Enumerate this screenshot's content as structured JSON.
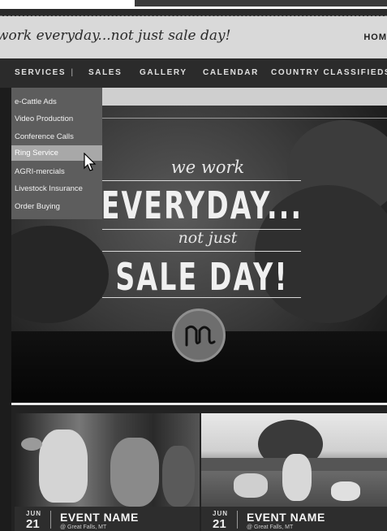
{
  "header": {
    "tagline": "work everyday...not just sale day!",
    "home_label": "HOM"
  },
  "nav": {
    "items": [
      {
        "label": "SERVICES"
      },
      {
        "label": "SALES"
      },
      {
        "label": "GALLERY"
      },
      {
        "label": "CALENDAR"
      },
      {
        "label": "COUNTRY CLASSIFIEDS"
      }
    ]
  },
  "dropdown": {
    "items": [
      {
        "label": "e-Cattle Ads"
      },
      {
        "label": "Video Production"
      },
      {
        "label": "Conference Calls"
      },
      {
        "label": "Ring Service",
        "active": true
      },
      {
        "label": "AGRI-mercials"
      },
      {
        "label": "Livestock Insurance"
      },
      {
        "label": "Order Buying"
      }
    ]
  },
  "hero": {
    "we_work": "we work",
    "everyday": "EVERYDAY...",
    "not_just": "not just",
    "sale_day": "SALE DAY!"
  },
  "events": [
    {
      "month": "JUN",
      "day": "21",
      "name": "EVENT NAME",
      "location": "@ Great Falls, MT"
    },
    {
      "month": "JUN",
      "day": "21",
      "name": "EVENT NAME",
      "location": "@ Great Falls, MT"
    }
  ],
  "colors": {
    "nav_bg": "#2b2b2b",
    "dropdown_bg": "#5d5d5d",
    "dropdown_active": "#a8a8a8"
  }
}
